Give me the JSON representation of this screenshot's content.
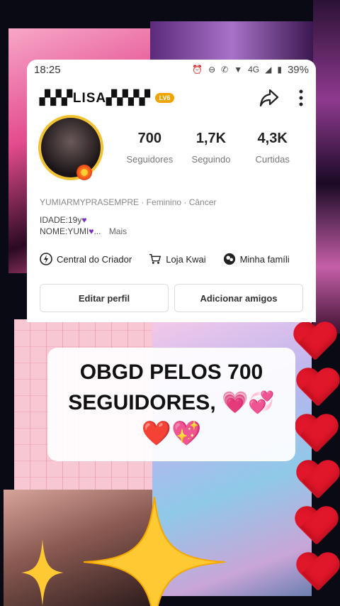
{
  "status_bar": {
    "time": "18:25",
    "battery": "39%",
    "network": "4G"
  },
  "profile": {
    "username": "▞▞▞LISA▞▞▞▞",
    "level_badge": "LV6",
    "stats": [
      {
        "value": "700",
        "label": "Seguidores"
      },
      {
        "value": "1,7K",
        "label": "Seguindo"
      },
      {
        "value": "4,3K",
        "label": "Curtidas"
      }
    ],
    "meta": "YUMIARMYPRASEMPRE · Feminino · Câncer",
    "bio_line1": "IDADE:19y",
    "bio_line2": "NOME:YUMI",
    "bio_more": "Mais",
    "links": [
      {
        "label": "Central do Criador",
        "icon": "lightning-icon"
      },
      {
        "label": "Loja Kwai",
        "icon": "cart-icon"
      },
      {
        "label": "Minha famíli",
        "icon": "family-icon"
      }
    ],
    "buttons": {
      "edit": "Editar perfil",
      "add_friends": "Adicionar amigos"
    }
  },
  "caption": {
    "line1": "OBGD PELOS 700",
    "line2": "SEGUIDORES,",
    "emoji_line2": "💗💞",
    "emoji_line3": "❤️💖"
  }
}
